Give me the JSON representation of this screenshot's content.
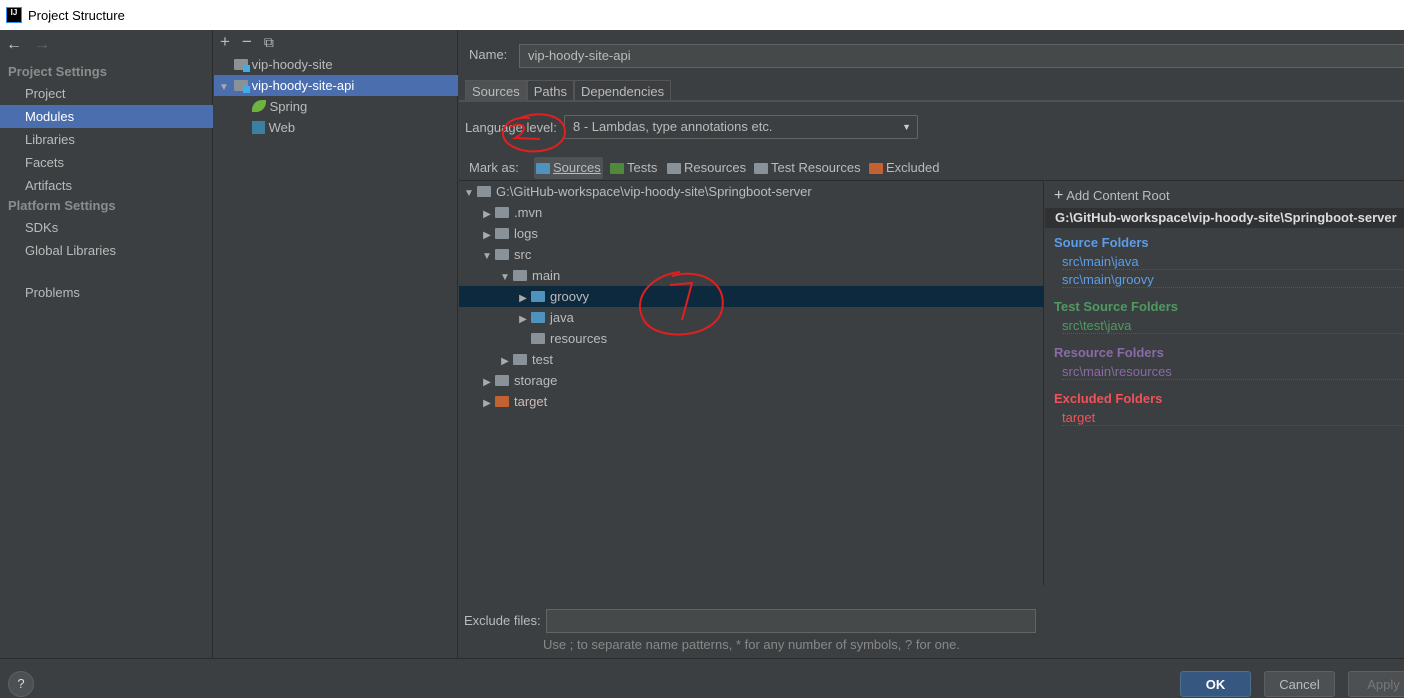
{
  "window": {
    "title": "Project Structure"
  },
  "nav": {
    "back": "←",
    "forward": "→"
  },
  "sidebar": {
    "project_settings": "Project Settings",
    "items_a": [
      {
        "label": "Project"
      },
      {
        "label": "Modules",
        "selected": true
      },
      {
        "label": "Libraries"
      },
      {
        "label": "Facets"
      },
      {
        "label": "Artifacts"
      }
    ],
    "platform_settings": "Platform Settings",
    "items_b": [
      {
        "label": "SDKs"
      },
      {
        "label": "Global Libraries"
      }
    ],
    "problems": "Problems"
  },
  "modules": {
    "toolbar": {
      "add": "+",
      "remove": "−",
      "copy": "⧉"
    },
    "items": [
      {
        "label": "vip-hoody-site"
      },
      {
        "label": "vip-hoody-site-api",
        "selected": true,
        "expanded": true
      },
      {
        "label": "Spring"
      },
      {
        "label": "Web"
      }
    ]
  },
  "detail": {
    "name_label": "Name:",
    "name_value": "vip-hoody-site-api",
    "tabs": [
      "Sources",
      "Paths",
      "Dependencies"
    ],
    "active_tab": "Sources",
    "language_label": "Language level:",
    "language_value": "8 - Lambdas, type annotations etc.",
    "mark_as": "Mark as:",
    "mark_items": [
      {
        "label": "Sources",
        "color": "#4d93bd"
      },
      {
        "label": "Tests",
        "color": "#4f8a3c"
      },
      {
        "label": "Resources",
        "color": "#8a9299"
      },
      {
        "label": "Test Resources",
        "color": "#8a9299"
      },
      {
        "label": "Excluded",
        "color": "#c26233"
      }
    ]
  },
  "tree": [
    {
      "label": "G:\\GitHub-workspace\\vip-hoody-site\\Springboot-server",
      "level": 0,
      "arrow": "▼",
      "type": "gray"
    },
    {
      "label": ".mvn",
      "level": 1,
      "arrow": "▶",
      "type": "gray"
    },
    {
      "label": "logs",
      "level": 1,
      "arrow": "▶",
      "type": "gray"
    },
    {
      "label": "src",
      "level": 1,
      "arrow": "▼",
      "type": "gray"
    },
    {
      "label": "main",
      "level": 2,
      "arrow": "▼",
      "type": "gray"
    },
    {
      "label": "groovy",
      "level": 3,
      "arrow": "▶",
      "type": "blue",
      "selected": true
    },
    {
      "label": "java",
      "level": 3,
      "arrow": "▶",
      "type": "blue"
    },
    {
      "label": "resources",
      "level": 3,
      "arrow": "",
      "type": "gray"
    },
    {
      "label": "test",
      "level": 2,
      "arrow": "▶",
      "type": "gray"
    },
    {
      "label": "storage",
      "level": 1,
      "arrow": "▶",
      "type": "gray"
    },
    {
      "label": "target",
      "level": 1,
      "arrow": "▶",
      "type": "orange"
    }
  ],
  "content_root": {
    "add_label": "Add Content Root",
    "path": "G:\\GitHub-workspace\\vip-hoody-site\\Springboot-server",
    "groups": [
      {
        "title": "Source Folders",
        "color": "#5c9de8",
        "folders": [
          "src\\main\\java",
          "src\\main\\groovy"
        ]
      },
      {
        "title": "Test Source Folders",
        "color": "#4e9a5f",
        "folders": [
          "src\\test\\java"
        ]
      },
      {
        "title": "Resource Folders",
        "color": "#8a6aa8",
        "folders": [
          "src\\main\\resources"
        ]
      },
      {
        "title": "Excluded Folders",
        "color": "#f0525a",
        "folders": [
          "target"
        ]
      }
    ]
  },
  "exclude": {
    "label": "Exclude files:",
    "value": "",
    "hint": "Use ; to separate name patterns, * for any number of symbols, ? for one."
  },
  "buttons": {
    "help": "?",
    "ok": "OK",
    "cancel": "Cancel",
    "apply": "Apply"
  }
}
